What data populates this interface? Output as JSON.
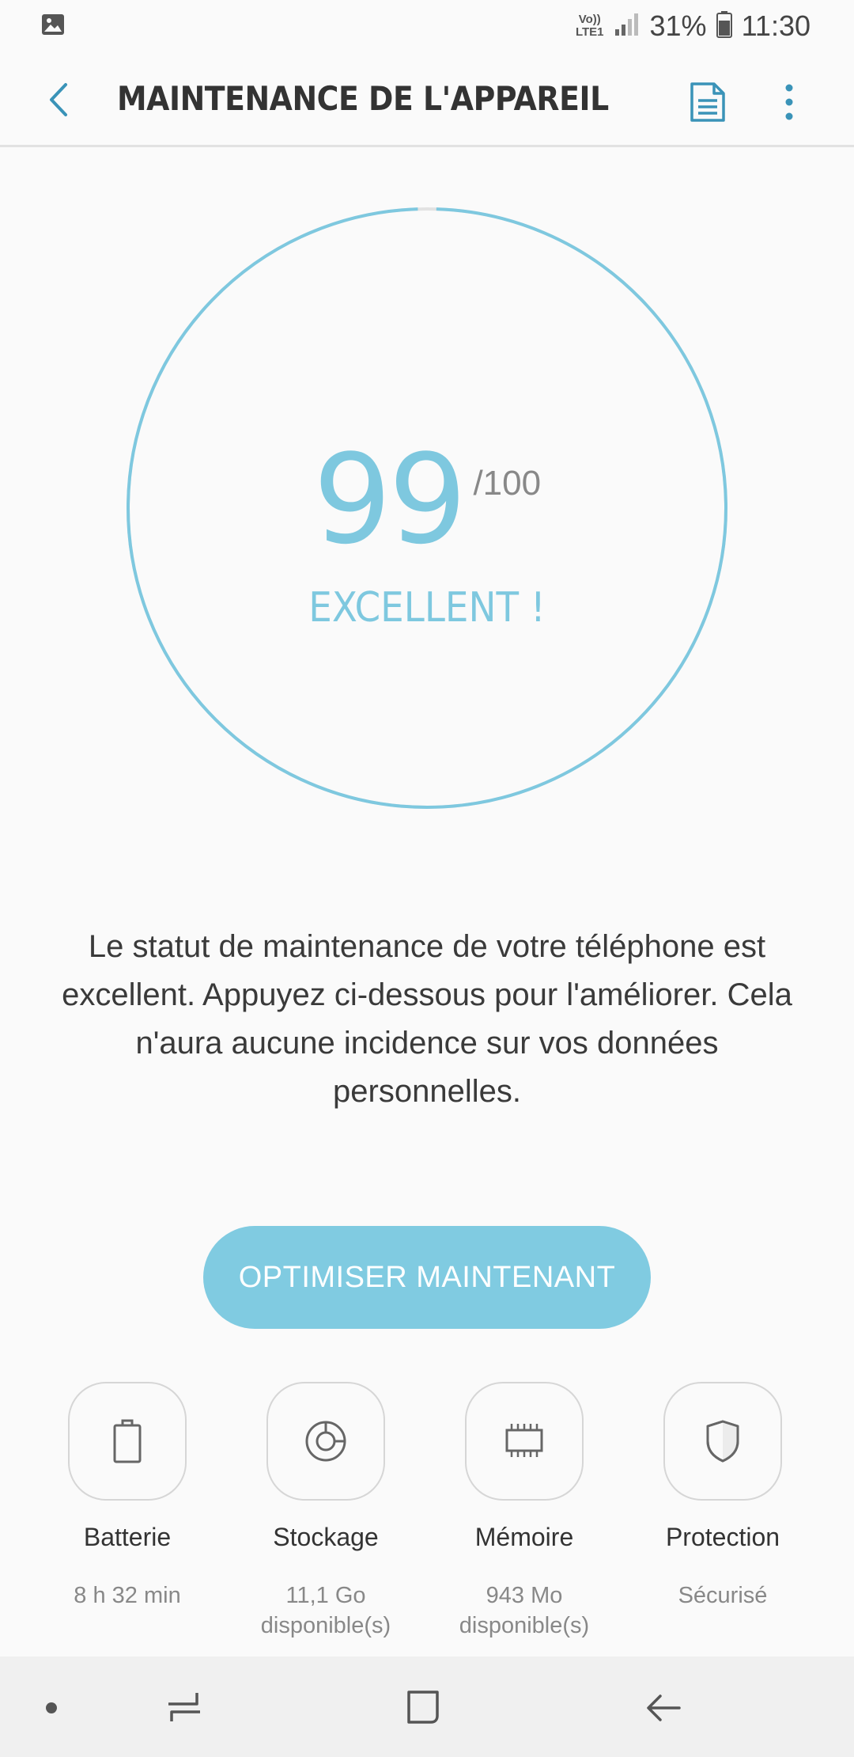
{
  "status_bar": {
    "battery_percent": "31%",
    "time": "11:30",
    "network_top": "Vo))",
    "network_bottom": "LTE1"
  },
  "app_bar": {
    "title": "MAINTENANCE DE L'APPAREIL"
  },
  "score": {
    "value": "99",
    "max": "/100",
    "rating": "EXCELLENT !",
    "fraction": 0.99
  },
  "description": "Le statut de maintenance de votre téléphone est excellent. Appuyez ci-dessous pour l'améliorer. Cela n'aura aucune incidence sur vos données personnelles.",
  "optimize_button": "OPTIMISER MAINTENANT",
  "categories": [
    {
      "label": "Batterie",
      "value": "8 h 32 min",
      "icon": "battery-icon"
    },
    {
      "label": "Stockage",
      "value": "11,1 Go disponible(s)",
      "icon": "storage-icon"
    },
    {
      "label": "Mémoire",
      "value": "943 Mo disponible(s)",
      "icon": "memory-chip-icon"
    },
    {
      "label": "Protection",
      "value": "Sécurisé",
      "icon": "shield-icon"
    }
  ],
  "colors": {
    "accent": "#7ec8df",
    "button": "#80cbe1"
  }
}
